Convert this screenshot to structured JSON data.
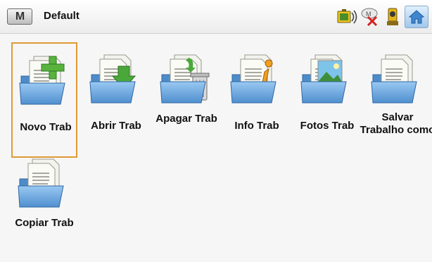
{
  "header": {
    "menu_label": "M",
    "title": "Default",
    "status_icons": [
      "battery-radio-icon",
      "gnss-disconnected-icon",
      "total-station-icon"
    ],
    "home_icon": "home-icon"
  },
  "tiles": [
    {
      "name": "novo-trab",
      "label": "Novo Trab",
      "icon": "folder-plus-icon",
      "selected": true
    },
    {
      "name": "abrir-trab",
      "label": "Abrir Trab",
      "icon": "folder-open-arrow-icon"
    },
    {
      "name": "apagar-trab",
      "label": "Apagar Trab",
      "icon": "folder-trash-icon"
    },
    {
      "name": "info-trab",
      "label": "Info Trab",
      "icon": "folder-info-icon"
    },
    {
      "name": "fotos-trab",
      "label": "Fotos Trab",
      "icon": "folder-photo-icon"
    },
    {
      "name": "salvar-trabalho-como",
      "label": "Salvar Trabalho como",
      "icon": "folder-save-as-icon"
    },
    {
      "name": "copiar-trab",
      "label": "Copiar Trab",
      "icon": "folder-copy-icon"
    }
  ],
  "colors": {
    "selection_border": "#e09a32",
    "folder_blue": "#5d9ad6",
    "plus_green": "#4aa83a"
  }
}
